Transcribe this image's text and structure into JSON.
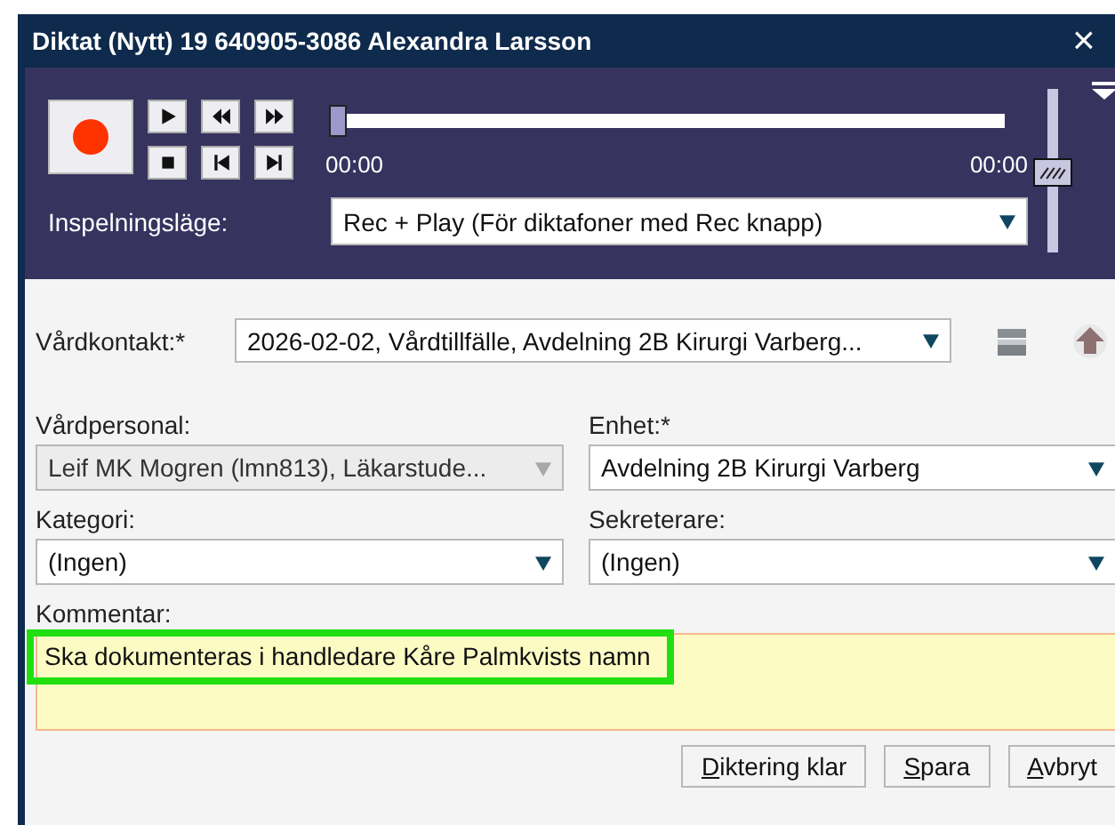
{
  "window": {
    "title": "Diktat (Nytt) 19 640905-3086 Alexandra Larsson",
    "close": "×"
  },
  "player": {
    "position": {
      "level": 0
    },
    "time_start": "00:00",
    "time_end": "00:00",
    "volume": {
      "level": 0.5
    },
    "mode_label": "Inspelningsläge:",
    "mode_value": "Rec + Play (För diktafoner med Rec knapp)"
  },
  "vardkontakt": {
    "label": "Vårdkontakt:*",
    "value": "2026-02-02, Vårdtillfälle, Avdelning 2B Kirurgi Varberg..."
  },
  "fields": [
    {
      "label": "Vårdpersonal:",
      "value": "Leif MK Mogren (lmn813), Läkarstude...",
      "disabled": true
    },
    {
      "label": "Enhet:*",
      "value": "Avdelning 2B Kirurgi Varberg",
      "disabled": false
    },
    {
      "label": "Kategori:",
      "value": "(Ingen)",
      "disabled": false
    },
    {
      "label": "Sekreterare:",
      "value": "(Ingen)",
      "disabled": false
    }
  ],
  "comment": {
    "label": "Kommentar:",
    "value": "Ska dokumenteras i handledare Kåre Palmkvists namn",
    "highlighted": true
  },
  "buttons": [
    "Diktering klar",
    "Spara",
    "Avbryt"
  ]
}
